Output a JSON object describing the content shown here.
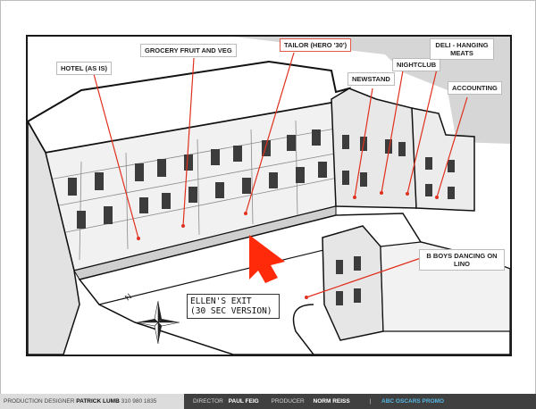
{
  "labels": {
    "hotel": "HOTEL (AS IS)",
    "grocery": "GROCERY FRUIT AND VEG",
    "tailor": "TAILOR (HERO '30')",
    "newsstand": "NEWSTAND",
    "nightclub": "NIGHTCLUB",
    "deli": "DELI  - HANGING MEATS",
    "accounting": "ACCOUNTING",
    "bboys": "B BOYS DANCING ON LINO"
  },
  "exit_label": {
    "line1": "ELLEN'S EXIT",
    "line2": "(30 SEC VERSION)"
  },
  "compass": {
    "north": "N"
  },
  "footer": {
    "designer_role": "PRODUCTION DESIGNER",
    "designer_name": "PATRICK LUMB",
    "designer_phone": "310 980 1835",
    "director_role": "DIRECTOR",
    "director_name": "PAUL FEIG",
    "producer_role": "PRODUCER",
    "producer_name": "NORM REISS",
    "separator": "|",
    "project": "ABC OSCARS PROMO"
  },
  "colors": {
    "leader": "#e0301e",
    "arrow": "#ff2a0a",
    "ink": "#1a1a1a",
    "promo": "#55b6e4"
  }
}
